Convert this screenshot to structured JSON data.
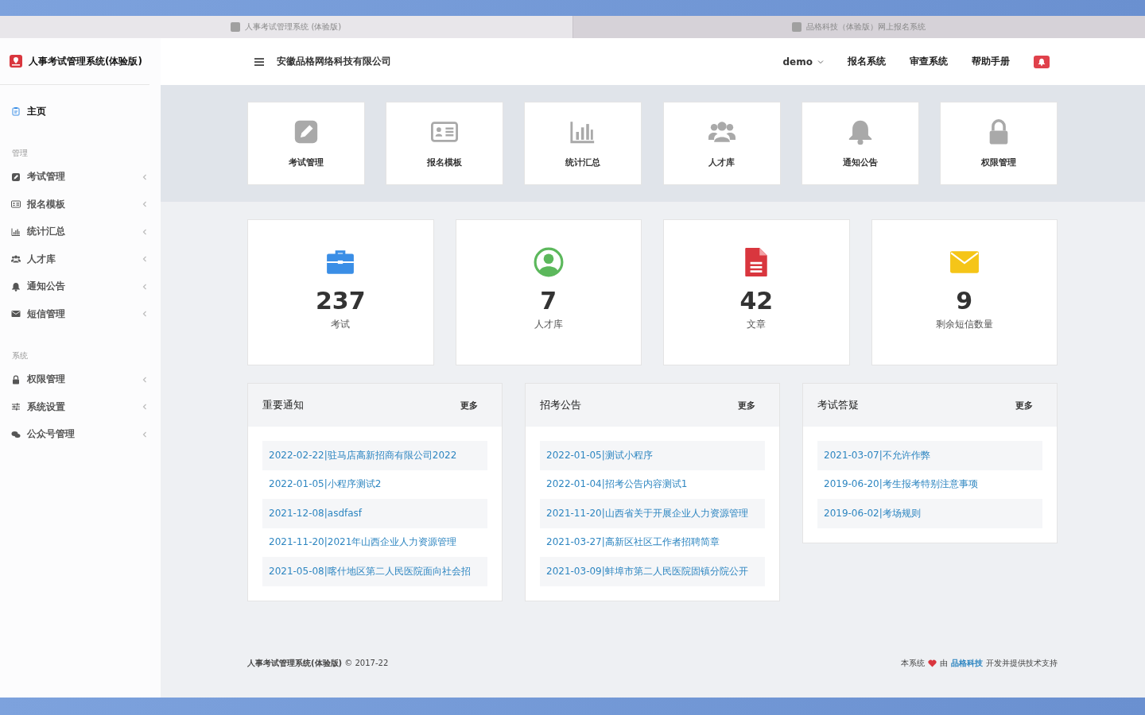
{
  "browser_tabs": [
    {
      "title": "人事考试管理系统 (体验版)",
      "selected": true
    },
    {
      "title": "品格科技（体验版）网上报名系统",
      "selected": false
    }
  ],
  "sidebar": {
    "title": "人事考试管理系统(体验版)",
    "home": {
      "label": "主页",
      "selected": true
    },
    "sections": [
      {
        "heading": "管理",
        "items": [
          "考试管理",
          "报名模板",
          "统计汇总",
          "人才库",
          "通知公告",
          "短信管理"
        ]
      },
      {
        "heading": "系统",
        "items": [
          "权限管理",
          "系统设置",
          "公众号管理"
        ]
      }
    ]
  },
  "header": {
    "company": "安徽品格网络科技有限公司",
    "user": "demo",
    "links": [
      "报名系统",
      "审查系统",
      "帮助手册"
    ]
  },
  "quick_tiles": [
    "考试管理",
    "报名模板",
    "统计汇总",
    "人才库",
    "通知公告",
    "权限管理"
  ],
  "stats": [
    {
      "value": "237",
      "label": "考试",
      "color": "#3a8ee6"
    },
    {
      "value": "7",
      "label": "人才库",
      "color": "#5cb85c"
    },
    {
      "value": "42",
      "label": "文章",
      "color": "#d9363e"
    },
    {
      "value": "9",
      "label": "剩余短信数量",
      "color": "#f5c518"
    }
  ],
  "panels": [
    {
      "title": "重要通知",
      "more": "更多",
      "items": [
        "2022-02-22|驻马店高新招商有限公司2022",
        "2022-01-05|小程序测试2",
        "2021-12-08|asdfasf",
        "2021-11-20|2021年山西企业人力资源管理",
        "2021-05-08|喀什地区第二人民医院面向社会招"
      ]
    },
    {
      "title": "招考公告",
      "more": "更多",
      "items": [
        "2022-01-05|测试小程序",
        "2022-01-04|招考公告内容测试1",
        "2021-11-20|山西省关于开展企业人力资源管理",
        "2021-03-27|高新区社区工作者招聘简章",
        "2021-03-09|蚌埠市第二人民医院固镇分院公开"
      ]
    },
    {
      "title": "考试答疑",
      "more": "更多",
      "items": [
        "2021-03-07|不允许作弊",
        "2019-06-20|考生报考特别注意事项",
        "2019-06-02|考场规则"
      ]
    }
  ],
  "footer": {
    "left": "**人事考试管理系统(体验版)** © 2017-22",
    "right_before": "本系统",
    "right_by": "由",
    "right_link": "品格科技",
    "right_after": "开发并提供技术支持"
  }
}
